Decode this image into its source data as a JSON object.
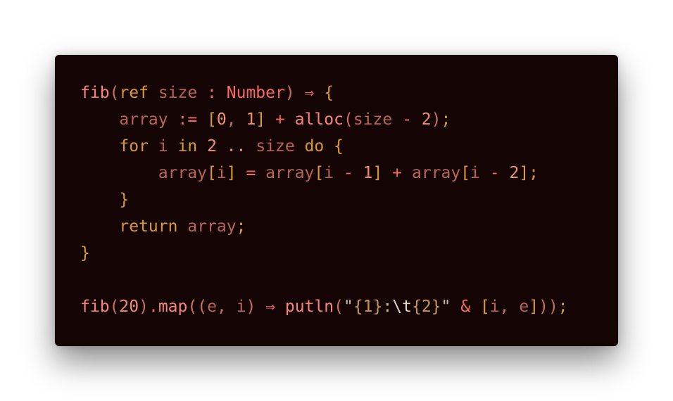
{
  "editor": {
    "colors": {
      "background": "#140404",
      "function": "#f7847b",
      "keyword": "#d89a37",
      "variable": "#b86457",
      "number": "#f28e6f",
      "operator": "#f46a60",
      "string": "#c8b8a0"
    },
    "lines": [
      [
        {
          "t": "fib",
          "k": "fn"
        },
        {
          "t": "(",
          "k": "punc"
        },
        {
          "t": "ref",
          "k": "kw"
        },
        {
          "t": " ",
          "k": "plain"
        },
        {
          "t": "size",
          "k": "var"
        },
        {
          "t": " : ",
          "k": "op"
        },
        {
          "t": "Number",
          "k": "type"
        },
        {
          "t": ") ",
          "k": "punc"
        },
        {
          "t": "⇒",
          "k": "op"
        },
        {
          "t": " ",
          "k": "plain"
        },
        {
          "t": "{",
          "k": "brace"
        }
      ],
      [
        {
          "t": "    ",
          "k": "plain"
        },
        {
          "t": "array",
          "k": "var"
        },
        {
          "t": " := ",
          "k": "op"
        },
        {
          "t": "[",
          "k": "brak"
        },
        {
          "t": "0",
          "k": "num"
        },
        {
          "t": ", ",
          "k": "punc"
        },
        {
          "t": "1",
          "k": "num"
        },
        {
          "t": "]",
          "k": "brak"
        },
        {
          "t": " + ",
          "k": "op"
        },
        {
          "t": "alloc",
          "k": "fn"
        },
        {
          "t": "(",
          "k": "punc"
        },
        {
          "t": "size",
          "k": "var"
        },
        {
          "t": " - ",
          "k": "op"
        },
        {
          "t": "2",
          "k": "num"
        },
        {
          "t": ")",
          "k": "punc"
        },
        {
          "t": ";",
          "k": "semi"
        }
      ],
      [
        {
          "t": "    ",
          "k": "plain"
        },
        {
          "t": "for",
          "k": "kw"
        },
        {
          "t": " ",
          "k": "plain"
        },
        {
          "t": "i",
          "k": "var"
        },
        {
          "t": " ",
          "k": "plain"
        },
        {
          "t": "in",
          "k": "kw"
        },
        {
          "t": " ",
          "k": "plain"
        },
        {
          "t": "2",
          "k": "num"
        },
        {
          "t": " .. ",
          "k": "kw"
        },
        {
          "t": "size",
          "k": "var"
        },
        {
          "t": " ",
          "k": "plain"
        },
        {
          "t": "do",
          "k": "kw"
        },
        {
          "t": " ",
          "k": "plain"
        },
        {
          "t": "{",
          "k": "brace"
        }
      ],
      [
        {
          "t": "        ",
          "k": "plain"
        },
        {
          "t": "array",
          "k": "var"
        },
        {
          "t": "[",
          "k": "brak"
        },
        {
          "t": "i",
          "k": "var"
        },
        {
          "t": "]",
          "k": "brak"
        },
        {
          "t": " = ",
          "k": "op"
        },
        {
          "t": "array",
          "k": "var"
        },
        {
          "t": "[",
          "k": "brak"
        },
        {
          "t": "i",
          "k": "var"
        },
        {
          "t": " - ",
          "k": "op"
        },
        {
          "t": "1",
          "k": "num"
        },
        {
          "t": "]",
          "k": "brak"
        },
        {
          "t": " + ",
          "k": "op"
        },
        {
          "t": "array",
          "k": "var"
        },
        {
          "t": "[",
          "k": "brak"
        },
        {
          "t": "i",
          "k": "var"
        },
        {
          "t": " - ",
          "k": "op"
        },
        {
          "t": "2",
          "k": "num"
        },
        {
          "t": "]",
          "k": "brak"
        },
        {
          "t": ";",
          "k": "semi"
        }
      ],
      [
        {
          "t": "    ",
          "k": "plain"
        },
        {
          "t": "}",
          "k": "brace"
        }
      ],
      [
        {
          "t": "    ",
          "k": "plain"
        },
        {
          "t": "return",
          "k": "kw"
        },
        {
          "t": " ",
          "k": "plain"
        },
        {
          "t": "array",
          "k": "var"
        },
        {
          "t": ";",
          "k": "semi"
        }
      ],
      [
        {
          "t": "}",
          "k": "brace"
        }
      ],
      [],
      [
        {
          "t": "fib",
          "k": "fn"
        },
        {
          "t": "(",
          "k": "punc"
        },
        {
          "t": "20",
          "k": "num"
        },
        {
          "t": ")",
          "k": "punc"
        },
        {
          "t": ".",
          "k": "op"
        },
        {
          "t": "map",
          "k": "fn"
        },
        {
          "t": "((",
          "k": "punc"
        },
        {
          "t": "e",
          "k": "var"
        },
        {
          "t": ", ",
          "k": "punc"
        },
        {
          "t": "i",
          "k": "var"
        },
        {
          "t": ") ",
          "k": "punc"
        },
        {
          "t": "⇒",
          "k": "op"
        },
        {
          "t": " ",
          "k": "plain"
        },
        {
          "t": "putln",
          "k": "fn"
        },
        {
          "t": "(",
          "k": "punc"
        },
        {
          "t": "\"",
          "k": "str"
        },
        {
          "t": "{1}",
          "k": "strb"
        },
        {
          "t": ":",
          "k": "str"
        },
        {
          "t": "\\t",
          "k": "esc"
        },
        {
          "t": "{2}",
          "k": "strb"
        },
        {
          "t": "\"",
          "k": "str"
        },
        {
          "t": " & ",
          "k": "op"
        },
        {
          "t": "[",
          "k": "brak"
        },
        {
          "t": "i",
          "k": "var"
        },
        {
          "t": ", ",
          "k": "punc"
        },
        {
          "t": "e",
          "k": "var"
        },
        {
          "t": "]",
          "k": "brak"
        },
        {
          "t": "))",
          "k": "punc"
        },
        {
          "t": ";",
          "k": "semi"
        }
      ]
    ]
  }
}
